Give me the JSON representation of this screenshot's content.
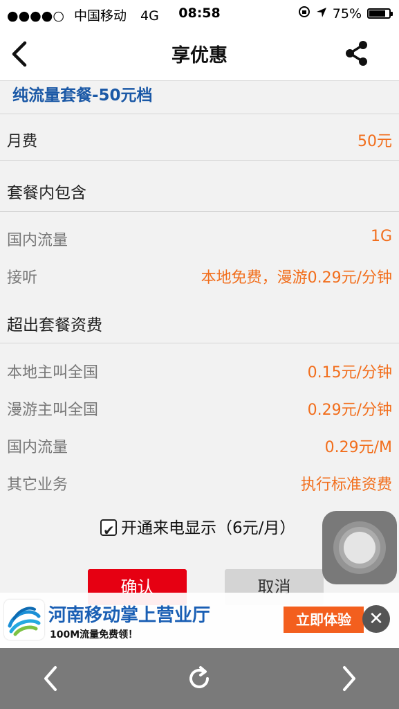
{
  "status_bar": {
    "signal": "●●●●○",
    "carrier": "中国移动",
    "network": "4G",
    "time": "08:58",
    "battery": "75%",
    "battery_level": 0.75
  },
  "nav": {
    "title": "享优惠"
  },
  "plan": {
    "title": "纯流量套餐-50元档",
    "fee_label": "月费",
    "fee_value": "50元"
  },
  "included": {
    "heading": "套餐内包含",
    "items": [
      {
        "label": "国内流量",
        "value": "1G"
      },
      {
        "label": "接听",
        "value": "本地免费，漫游0.29元/分钟"
      }
    ]
  },
  "overage": {
    "heading": "超出套餐资费",
    "items": [
      {
        "label": "本地主叫全国",
        "value": "0.15元/分钟"
      },
      {
        "label": "漫游主叫全国",
        "value": "0.29元/分钟"
      },
      {
        "label": "国内流量",
        "value": "0.29元/M"
      },
      {
        "label": "其它业务",
        "value": "执行标准资费"
      }
    ]
  },
  "caller_id": {
    "label": "开通来电显示（6元/月）",
    "checked": true
  },
  "actions": {
    "confirm": "确认",
    "cancel": "取消"
  },
  "ad": {
    "title": "河南移动掌上营业厅",
    "subtitle": "100M流量免费领！",
    "cta": "立即体验",
    "close": "✕"
  },
  "colors": {
    "accent": "#f26e1c",
    "plan_title": "#1a58a6",
    "confirm": "#e60012",
    "cta": "#f35f1e"
  }
}
